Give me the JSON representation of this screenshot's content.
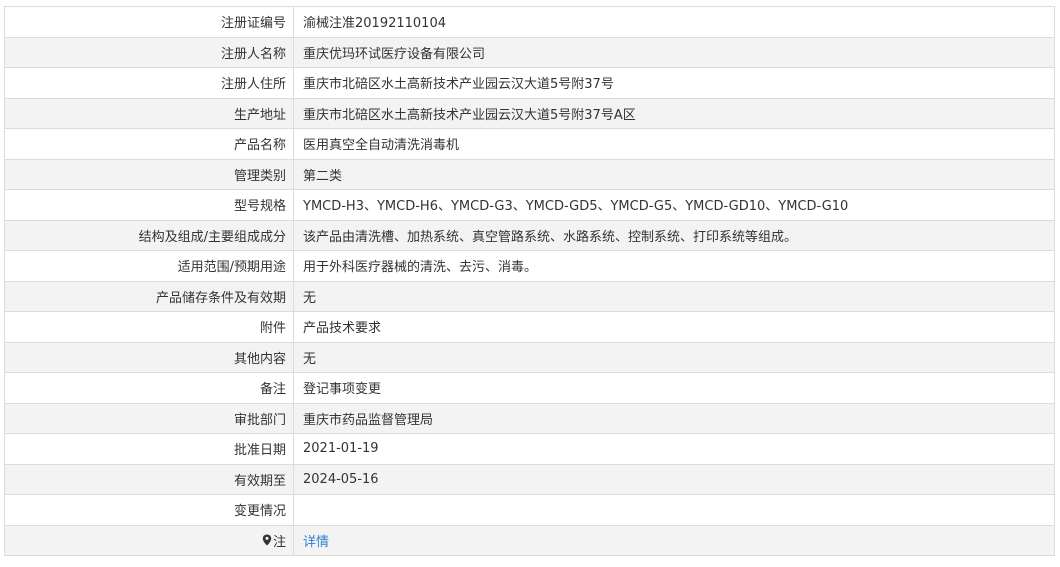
{
  "rows": [
    {
      "label": "注册证编号",
      "value": "渝械注准20192110104"
    },
    {
      "label": "注册人名称",
      "value": "重庆优玛环试医疗设备有限公司"
    },
    {
      "label": "注册人住所",
      "value": "重庆市北碚区水土高新技术产业园云汉大道5号附37号"
    },
    {
      "label": "生产地址",
      "value": "重庆市北碚区水土高新技术产业园云汉大道5号附37号A区"
    },
    {
      "label": "产品名称",
      "value": "医用真空全自动清洗消毒机"
    },
    {
      "label": "管理类别",
      "value": "第二类"
    },
    {
      "label": "型号规格",
      "value": "YMCD-H3、YMCD-H6、YMCD-G3、YMCD-GD5、YMCD-G5、YMCD-GD10、YMCD-G10"
    },
    {
      "label": "结构及组成/主要组成成分",
      "value": "该产品由清洗槽、加热系统、真空管路系统、水路系统、控制系统、打印系统等组成。"
    },
    {
      "label": "适用范围/预期用途",
      "value": "用于外科医疗器械的清洗、去污、消毒。"
    },
    {
      "label": "产品储存条件及有效期",
      "value": "无"
    },
    {
      "label": "附件",
      "value": "产品技术要求"
    },
    {
      "label": "其他内容",
      "value": "无"
    },
    {
      "label": "备注",
      "value": "登记事项变更"
    },
    {
      "label": "审批部门",
      "value": "重庆市药品监督管理局"
    },
    {
      "label": "批准日期",
      "value": "2021-01-19"
    },
    {
      "label": "有效期至",
      "value": "2024-05-16"
    },
    {
      "label": "变更情况",
      "value": ""
    }
  ],
  "note_row": {
    "label": "注",
    "icon": "map-pin-icon",
    "link_text": "详情",
    "link_color": "#2d7fd2"
  }
}
